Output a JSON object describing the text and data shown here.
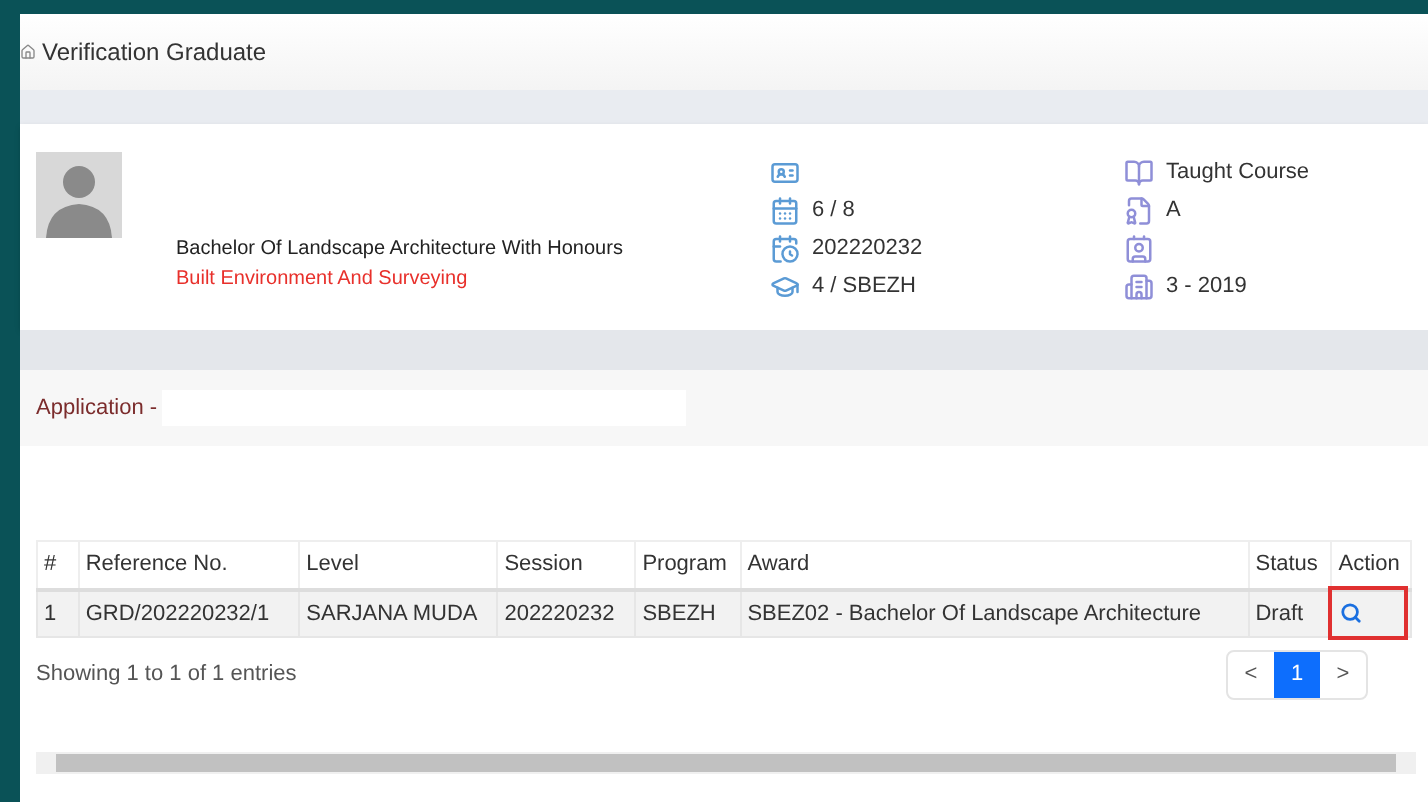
{
  "header": {
    "title": "Verification Graduate"
  },
  "profile": {
    "program": "Bachelor Of Landscape Architecture With Honours",
    "faculty": "Built Environment And Surveying"
  },
  "info_left": [
    {
      "kind": "icon"
    },
    {
      "kind": "value",
      "text": "6 / 8"
    },
    {
      "kind": "value",
      "text": "202220232"
    },
    {
      "kind": "value",
      "text": "4 / SBEZH"
    }
  ],
  "info_right": [
    {
      "kind": "value",
      "text": "Taught Course"
    },
    {
      "kind": "value",
      "text": "A"
    },
    {
      "kind": "icon"
    },
    {
      "kind": "value",
      "text": "3 - 2019"
    }
  ],
  "application": {
    "label": "Application -"
  },
  "table": {
    "columns": [
      "#",
      "Reference No.",
      "Level",
      "Session",
      "Program",
      "Award",
      "Status",
      "Action"
    ],
    "rows": [
      {
        "cells": [
          "1",
          "GRD/202220232/1",
          "SARJANA MUDA",
          "202220232",
          "SBEZH",
          "SBEZ02 - Bachelor Of Landscape Architecture",
          "Draft"
        ],
        "highlighted": true
      }
    ]
  },
  "footer": {
    "info": "Showing 1 to 1 of 1 entries",
    "prev": "<",
    "pages": [
      {
        "label": "1",
        "selected": true
      }
    ],
    "next": ">"
  }
}
